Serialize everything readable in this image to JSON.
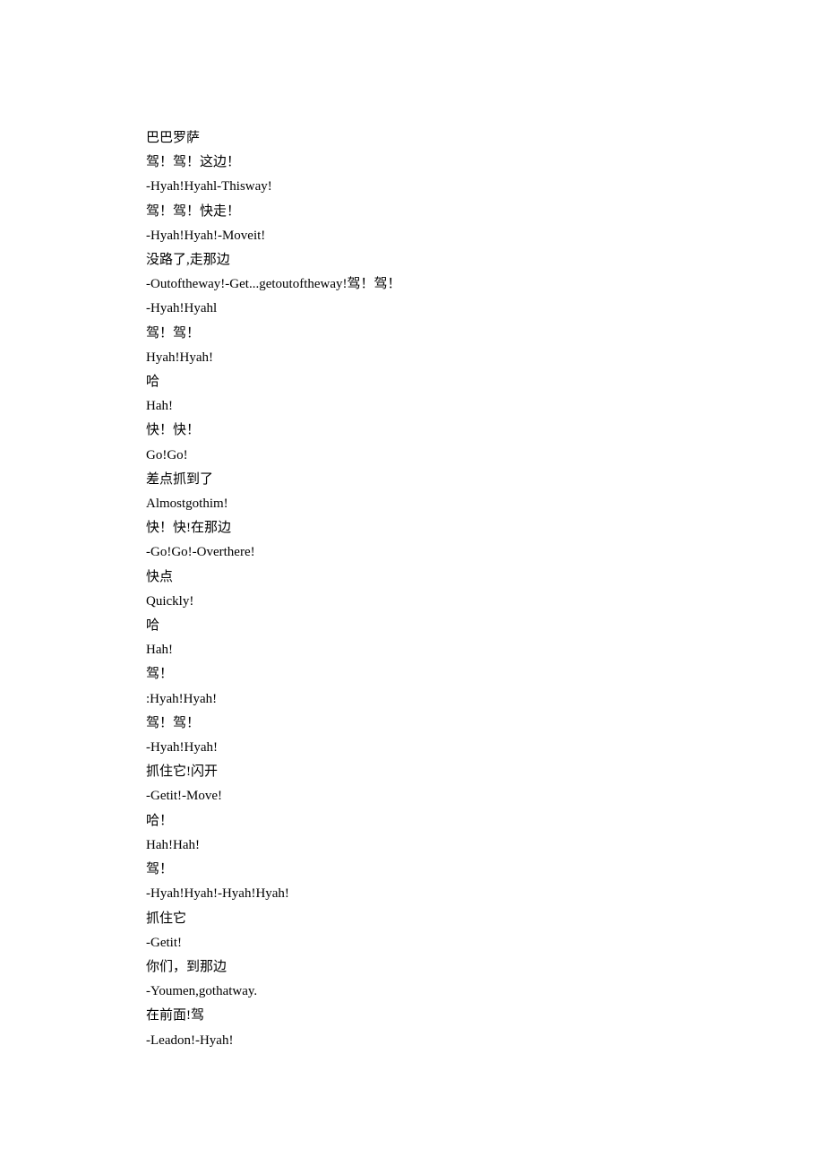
{
  "lines": [
    "巴巴罗萨",
    "驾！驾！这边！",
    "-Hyah!Hyahl-Thisway!",
    "驾！驾！快走！",
    "-Hyah!Hyah!-Moveit!",
    "没路了,走那边",
    "-Outoftheway!-Get...getoutoftheway!驾！驾！",
    "-Hyah!Hyahl",
    "驾！驾！",
    "Hyah!Hyah!",
    "哈",
    "Hah!",
    "快！快！",
    "Go!Go!",
    "差点抓到了",
    "Almostgothim!",
    "快！快!在那边",
    "-Go!Go!-Overthere!",
    "快点",
    "Quickly!",
    "哈",
    "Hah!",
    "驾！",
    ":Hyah!Hyah!",
    "驾！驾！",
    "-Hyah!Hyah!",
    "抓住它!闪开",
    "-Getit!-Move!",
    "哈！",
    "Hah!Hah!",
    "驾！",
    "-Hyah!Hyah!-Hyah!Hyah!",
    "抓住它",
    "-Getit!",
    "你们，到那边",
    "-Youmen,gothatway.",
    "在前面!驾",
    "-Leadon!-Hyah!"
  ]
}
